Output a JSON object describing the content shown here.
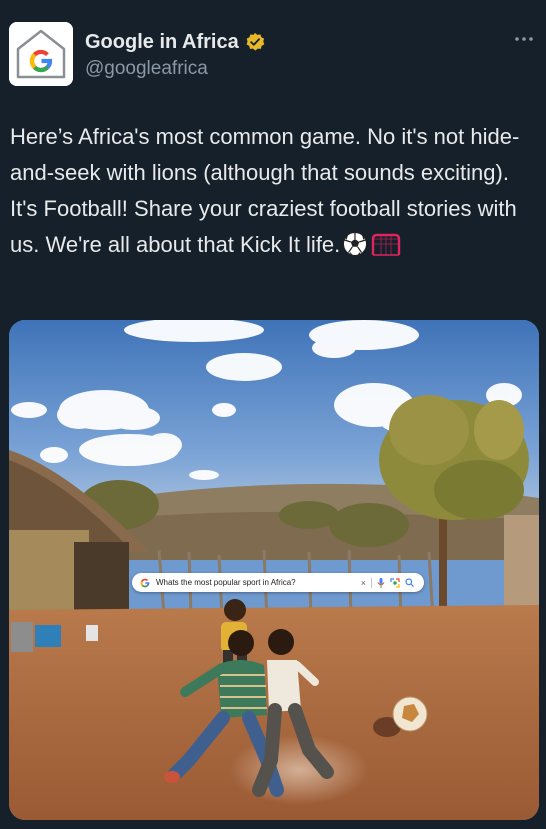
{
  "tweet": {
    "display_name": "Google in Africa",
    "handle": "@googleafrica",
    "verified_badge_color": "#e8b82b",
    "more_icon": "more-horizontal-icon",
    "text": "Here’s Africa's most common game. No it's not hide-and-seek with lions (although that sounds exciting). It's Football! Share your craziest football stories with us. We're all about that Kick It life.",
    "emojis": [
      "soccer-ball-icon",
      "goal-net-icon"
    ]
  },
  "media": {
    "search_bar": {
      "query": "Whats the most popular sport in Africa?",
      "clear_glyph": "×",
      "tools": [
        "mic-icon",
        "lens-icon",
        "search-icon"
      ]
    }
  },
  "colors": {
    "background": "#15202b",
    "text_primary": "#e7e9ea",
    "text_secondary": "#8b98a5"
  }
}
